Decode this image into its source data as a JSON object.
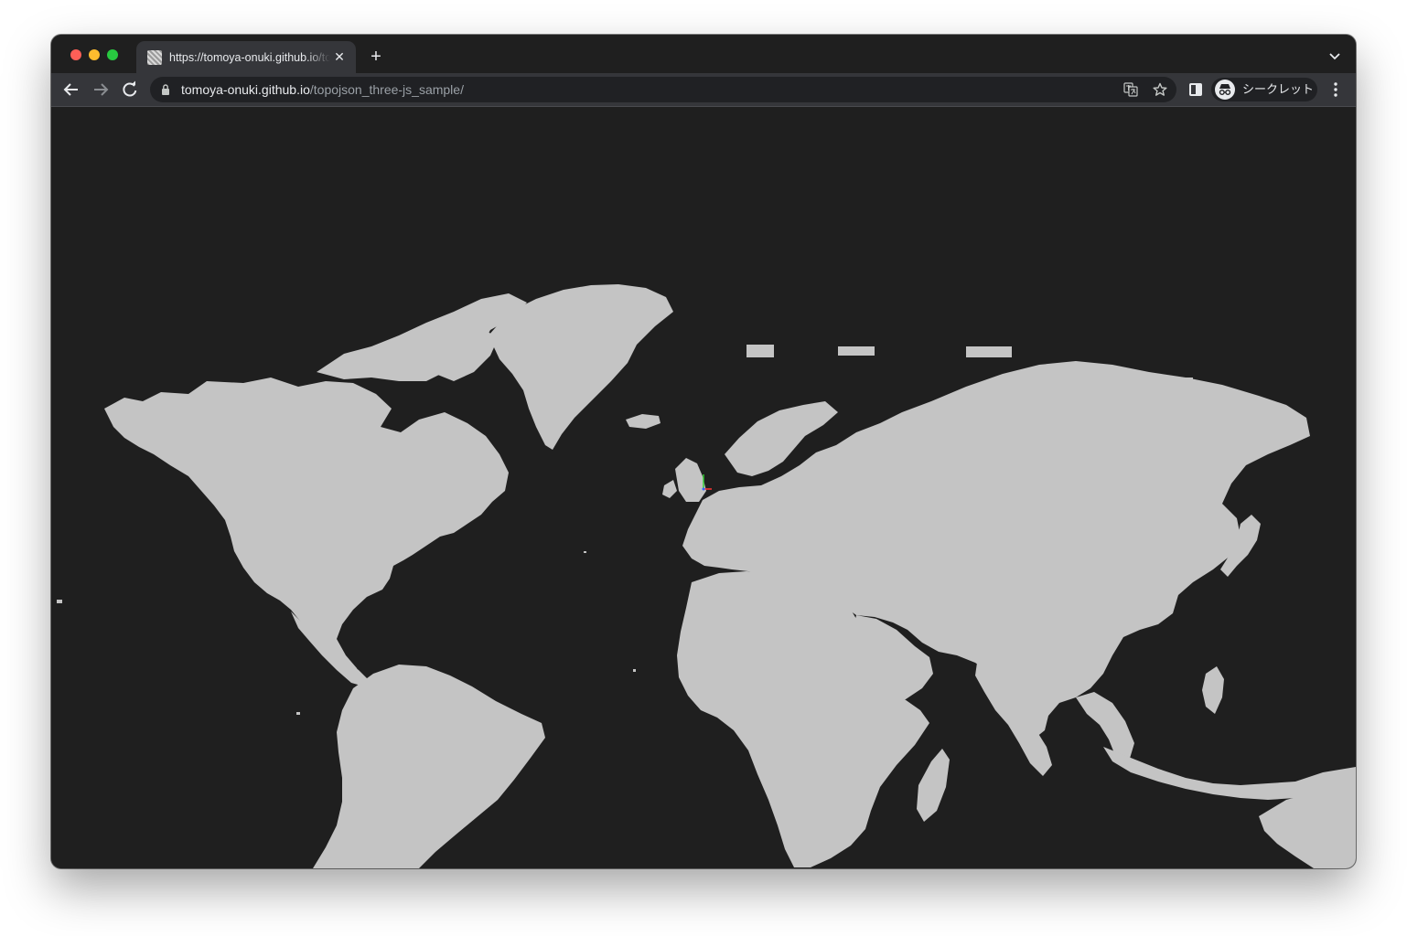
{
  "tab": {
    "title": "https://tomoya-onuki.github.io/topojson_three-js_sample/",
    "close_glyph": "✕",
    "new_tab_glyph": "+"
  },
  "toolbar": {
    "url_host": "tomoya-onuki.github.io",
    "url_path": "/topojson_three-js_sample/",
    "incognito_label": "シークレット"
  },
  "icons": {
    "back": "arrow-left-icon",
    "forward": "arrow-right-icon",
    "reload": "reload-icon",
    "lock": "lock-icon",
    "translate": "translate-icon",
    "bookmark": "star-icon",
    "side_panel": "side-panel-icon",
    "incognito": "incognito-icon",
    "menu": "kebab-menu-icon",
    "tab_search": "chevron-down-icon"
  },
  "colors": {
    "page_background": "#1f1f1f",
    "land": "#c4c4c4",
    "toolbar": "#35363a",
    "omnibox": "#202124",
    "axis_x": "#ff3333",
    "axis_y": "#33cc33",
    "axis_z": "#3366ff"
  }
}
